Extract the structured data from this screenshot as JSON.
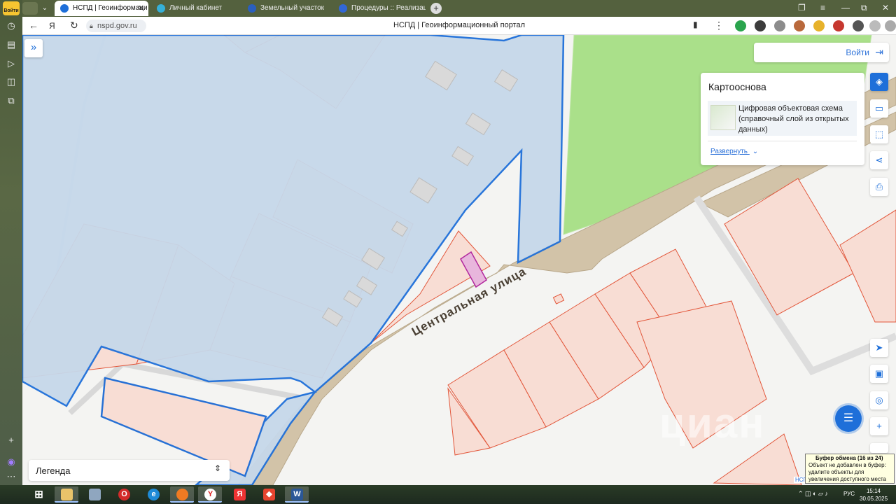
{
  "browser": {
    "rail_badge": "Войти",
    "tabs": [
      {
        "label": "НСПД | Геоинформаци",
        "active": true
      },
      {
        "label": "Личный кабинет",
        "active": false
      },
      {
        "label": "Земельный участок",
        "active": false
      },
      {
        "label": "Процедуры :: Реализаци",
        "active": false
      }
    ],
    "url": "nspd.gov.ru",
    "page_title": "НСПД | Геоинформационный портал",
    "tab_close": "✕",
    "new_tab": "+"
  },
  "map": {
    "street_label": "Центральная  улица",
    "watermark": "циан",
    "corner_tag": "НСП"
  },
  "header": {
    "login_label": "Войти"
  },
  "basemap": {
    "title": "Картооснова",
    "layer_name": "Цифровая объектовая схема (справочный слой из открытых данных)",
    "expand_link": "Развернуть"
  },
  "legend": {
    "label": "Легенда"
  },
  "clipboard_toast": {
    "title": "Буфер обмена (16 из 24)",
    "message": "Объект не добавлен в буфер: удалите объекты для увеличения доступного места"
  },
  "taskbar": {
    "lang": "РУС",
    "time": "15:14",
    "date": "30.05.2025"
  },
  "colors": {
    "accent": "#1e6fd9",
    "parcel_fill": "#f8ddd4",
    "parcel_stroke": "#e2563a",
    "highlight_fill": "#c6d8ea",
    "road_fill": "#d1c3a9",
    "green_area": "#a9e08a",
    "selected": "#b2289e"
  }
}
